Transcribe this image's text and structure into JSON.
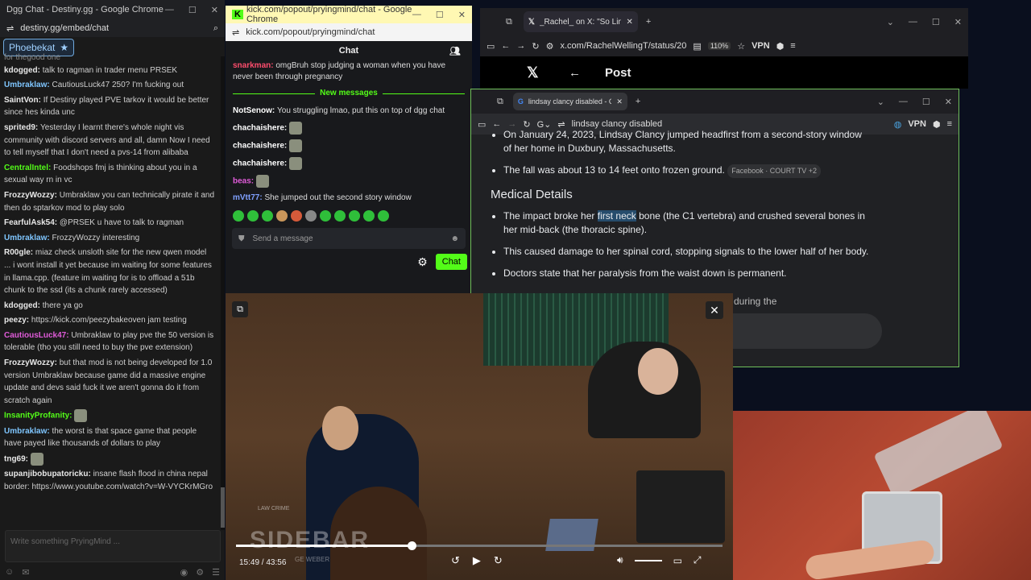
{
  "dgg": {
    "window_title": "Dgg Chat - Destiny.gg - Google Chrome",
    "url": "destiny.gg/embed/chat",
    "current_user": "Phoebekat",
    "partial_line": "for thegood one",
    "messages": [
      {
        "user": "kdogged",
        "text": "talk to ragman in trader menu PRSEK",
        "color": "#e8e8e8"
      },
      {
        "user": "Umbraklaw",
        "text": "CautiousLuck47 250? I'm fucking out",
        "color": "#7fc6ff"
      },
      {
        "user": "SaintVon",
        "text": "If Destiny played PVE tarkov it would be better since hes kinda unc",
        "color": "#e8e8e8"
      },
      {
        "user": "sprited9",
        "text": "Yesterday I learnt there's whole night vis community with discord servers and all, damn Now I need to tell myself that I don't need a pvs-14 from alibaba",
        "color": "#e8e8e8"
      },
      {
        "user": "CentralIntel",
        "text": "Foodshops fmj is thinking about you in a sexual way rn in vc",
        "color": "#53fc18"
      },
      {
        "user": "FrozzyWozzy",
        "text": "Umbraklaw you can technically pirate it and then do sptarkov mod to play solo",
        "color": "#e8e8e8"
      },
      {
        "user": "FearfulAsk54",
        "text": "@PRSEK u have to talk to ragman",
        "color": "#e8e8e8"
      },
      {
        "user": "Umbraklaw",
        "text": "FrozzyWozzy interesting",
        "color": "#7fc6ff"
      },
      {
        "user": "R00gle",
        "text": "miaz check unsloth site for the new qwen model ... i wont install it yet because im waiting for some features in llama.cpp. (feature im waiting for is to offload a 51b chunk to the ssd (its a chunk rarely accessed)",
        "color": "#e8e8e8"
      },
      {
        "user": "kdogged",
        "text": "there ya go",
        "color": "#e8e8e8"
      },
      {
        "user": "peezy",
        "text": "https://kick.com/peezybakeoven jam testing",
        "color": "#e8e8e8"
      },
      {
        "user": "CautiousLuck47",
        "text": "Umbraklaw to play pve the 50 version is tolerable (tho you still need to buy the pve extension)",
        "color": "#e05bd9"
      },
      {
        "user": "FrozzyWozzy",
        "text": "but that mod is not being developed for 1.0 version Umbraklaw because game did a massive engine update and devs said fuck it we aren't gonna do it from scratch again",
        "color": "#e8e8e8"
      },
      {
        "user": "InsanityProfanity",
        "text": "",
        "color": "#53fc18"
      },
      {
        "user": "Umbraklaw",
        "text": "the worst is that space game that people have payed like thousands of dollars to play",
        "color": "#7fc6ff"
      },
      {
        "user": "tng69",
        "text": "",
        "color": "#e8e8e8"
      },
      {
        "user": "supanjibobupatoricku",
        "text": "insane flash flood in china nepal border: https://www.youtube.com/watch?v=W-VYCKrMGro",
        "color": "#e8e8e8"
      }
    ],
    "input_placeholder": "Write something PryingMind ..."
  },
  "kick": {
    "window_title": "kick.com/popout/pryingmind/chat - Google Chrome",
    "url": "kick.com/popout/pryingmind/chat",
    "header": "Chat",
    "messages_before": [
      {
        "user": "snarkman",
        "text": "omgBruh stop judging a woman when you have never been through pregnancy",
        "color": "#ff4d6d"
      }
    ],
    "new_messages_label": "New messages",
    "messages_after": [
      {
        "user": "NotSenow",
        "text": "You struggling lmao, put this on top of dgg chat",
        "color": "#ffffff"
      },
      {
        "user": "chachaishere",
        "text": "",
        "color": "#ffffff"
      },
      {
        "user": "chachaishere",
        "text": "",
        "color": "#ffffff"
      },
      {
        "user": "chachaishere",
        "text": "",
        "color": "#ffffff"
      },
      {
        "user": "beas",
        "text": "",
        "color": "#e05bd9"
      },
      {
        "user": "mVtt77",
        "text": "She jumped out the second story window",
        "color": "#7fa0ff"
      }
    ],
    "input_placeholder": "Send a message",
    "send_label": "Chat"
  },
  "xwin": {
    "tab_title": "_Rachel_ on X: \"So Lindsay Clancy",
    "url": "x.com/RachelWellingT/status/20",
    "zoom": "110%",
    "vpn": "VPN",
    "post_label": "Post"
  },
  "gwin": {
    "tab_title": "lindsay clancy disabled - Googl",
    "url": "lindsay clancy disabled",
    "vpn": "VPN",
    "bullet_top_1": "On January 24, 2023, Lindsay Clancy jumped headfirst from a second-story window of her home in Duxbury, Massachusetts.",
    "bullet_top_2": "The fall was about 13 to 14 feet onto frozen ground.",
    "source_chip": "Facebook · COURT TV +2",
    "heading": "Medical Details",
    "bullet_1_pre": "The impact broke her",
    "bullet_1_hl": "first neck",
    "bullet_1_post": "bone (the C1 vertebra) and crushed several bones in her mid-back (the thoracic spine).",
    "bullet_2": "This caused damage to her spinal cord, stopping signals to the lower half of her body.",
    "bullet_3": "Doctors state that her paralysis from the waist down is permanent.",
    "partial": "during the"
  },
  "video": {
    "time": "15:49 / 43:56",
    "progress_fraction": 0.361,
    "logo": "SIDEBAR",
    "logo_sub": "LAW CRIME",
    "logo_tag": "GE WEBER"
  }
}
